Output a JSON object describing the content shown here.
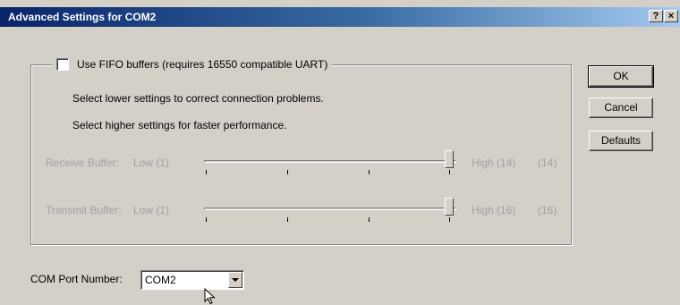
{
  "window": {
    "title": "Advanced Settings for COM2",
    "help_glyph": "?",
    "close_glyph": "×"
  },
  "fifo": {
    "checkbox_label": "Use FIFO buffers (requires 16550 compatible UART)",
    "checked": false,
    "hint_lower": "Select lower settings to correct connection problems.",
    "hint_higher": "Select higher settings for faster performance."
  },
  "receive_buffer": {
    "label": "Receive Buffer:",
    "low_label": "Low (1)",
    "high_label": "High (14)",
    "current_value": "(14)",
    "min": 1,
    "max": 14,
    "value": 14,
    "enabled": false
  },
  "transmit_buffer": {
    "label": "Transmit Buffer:",
    "low_label": "Low (1)",
    "high_label": "High (16)",
    "current_value": "(16)",
    "min": 1,
    "max": 16,
    "value": 16,
    "enabled": false
  },
  "buttons": {
    "ok": "OK",
    "cancel": "Cancel",
    "defaults": "Defaults"
  },
  "com_port": {
    "label": "COM Port Number:",
    "selected": "COM2"
  },
  "colors": {
    "title_gradient_start": "#0a246a",
    "title_gradient_end": "#a6caf0",
    "dialog_face": "#d4d0c8",
    "disabled_text": "#a0a0a0"
  },
  "icons": [
    "help-icon",
    "close-icon",
    "dropdown-arrow-icon",
    "mouse-pointer-icon"
  ]
}
